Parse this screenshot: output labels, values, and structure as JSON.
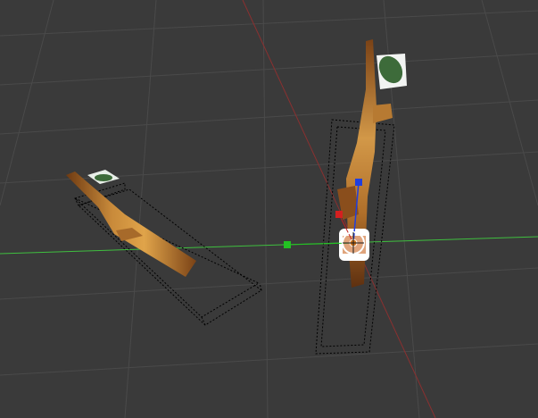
{
  "viewport": {
    "background_color": "#3a3a3a",
    "grid_color": "#4a4a4a",
    "x_axis_color": "#3fbf3f",
    "y_axis_color": "#8a3030"
  },
  "objects": [
    {
      "name": "branch-left",
      "selected": false
    },
    {
      "name": "branch-right",
      "selected": true
    }
  ],
  "gizmo": {
    "x_handle_color": "#d42020",
    "y_handle_color": "#22c022",
    "z_handle_color": "#1f3fe0"
  },
  "materials": {
    "bark_light": "#c88a3a",
    "bark_dark": "#6e3a12",
    "leaf_green": "#3d6b3a"
  }
}
